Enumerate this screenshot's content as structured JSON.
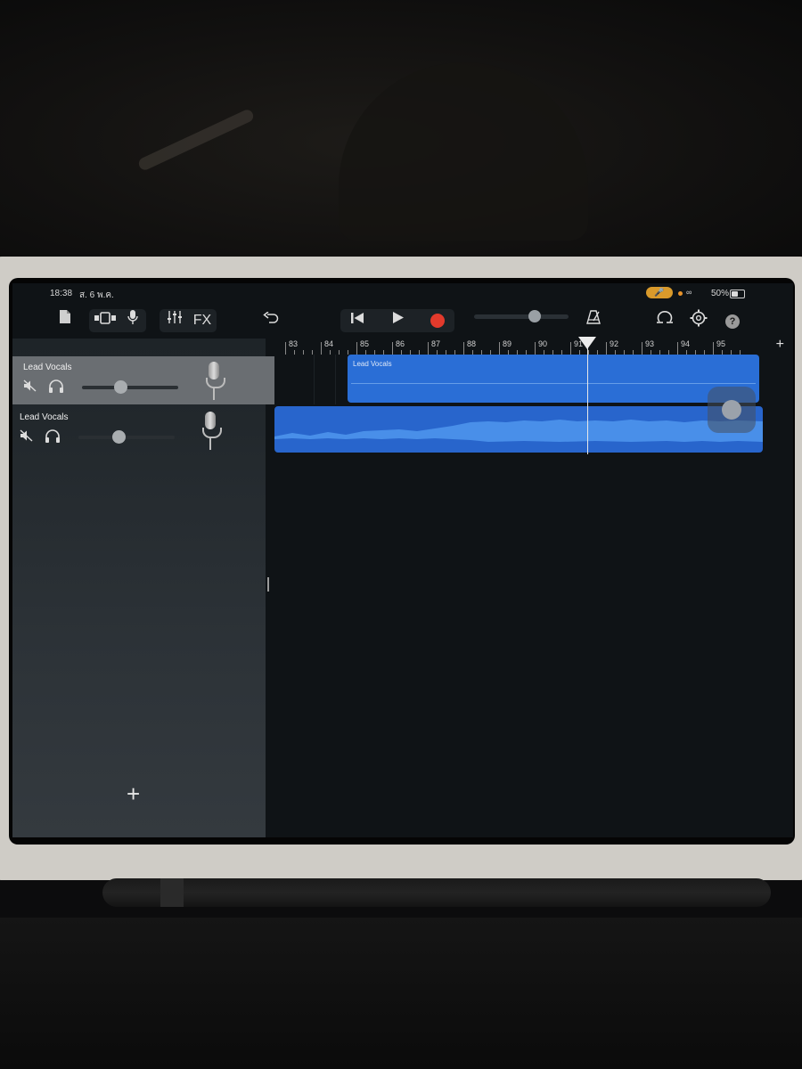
{
  "status_bar": {
    "time": "18:38",
    "date": "ส. 6 พ.ค.",
    "battery": "50%",
    "battery_level": 0.5
  },
  "toolbar": {
    "fx_label": "FX",
    "playhead_volume": 0.64,
    "help_label": "?"
  },
  "ruler": {
    "bars": [
      "83",
      "84",
      "85",
      "86",
      "87",
      "88",
      "89",
      "90",
      "91",
      "92",
      "93",
      "94",
      "95"
    ],
    "add_label": "+"
  },
  "tracks": [
    {
      "name": "Lead Vocals",
      "volume": 0.4,
      "selected": true
    },
    {
      "name": "Lead Vocals",
      "volume": 0.42,
      "selected": false
    }
  ],
  "regions": [
    {
      "label": "Lead Vocals"
    },
    {
      "label": ""
    }
  ],
  "track_panel": {
    "add_track_label": "+"
  },
  "colors": {
    "region_blue": "#2a6ed6",
    "record_red": "#e33a2c",
    "mic_pill": "#d99a2b"
  }
}
